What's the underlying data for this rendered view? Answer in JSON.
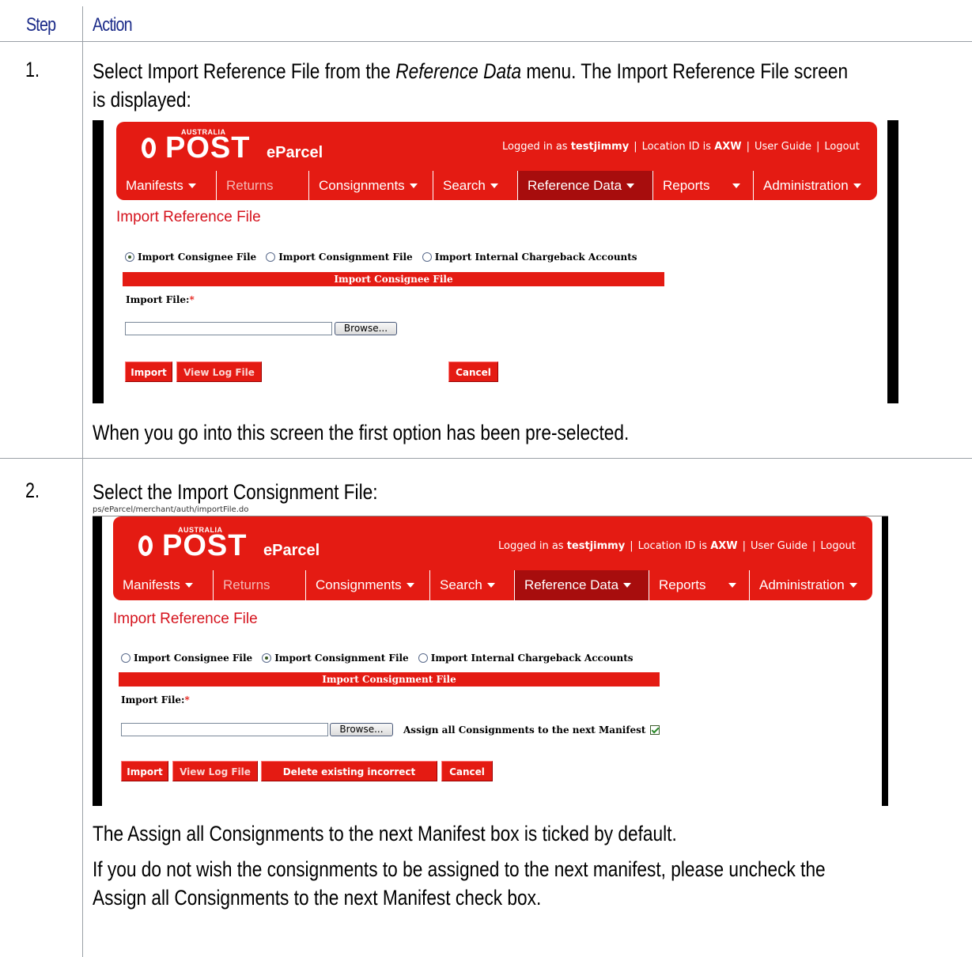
{
  "table": {
    "header": {
      "step": "Step",
      "action": "Action"
    }
  },
  "step1": {
    "number": "1.",
    "text_a": "Select ",
    "text_b": "Import Reference File",
    "text_c": " from the ",
    "text_d": "Reference Data",
    "text_e": " menu.  The ",
    "text_f": "Import Reference File",
    "text_g": " screen",
    "text_h": "is displayed:",
    "note": "When you go into this screen the first option has been pre-selected."
  },
  "step2": {
    "number": "2.",
    "text_a": "Select the ",
    "text_b": "Import Consignment File",
    "text_c": ":",
    "url": "ps/eParcel/merchant/auth/importFile.do",
    "note1_a": "The ",
    "note1_b": "Assign all Consignments to the next Manifest",
    "note1_c": " box is ticked by default.",
    "note2_line1": "If you do not wish the consignments to be assigned to the next manifest, please uncheck the",
    "note2_b": "Assign all Consignments to the next Manifest",
    "note2_c": " check box."
  },
  "app": {
    "logo_small": "AUSTRALIA",
    "logo_big": "POST",
    "logo_product": "eParcel",
    "login_prefix": "Logged in as ",
    "login_user": "testjimmy",
    "location_prefix": "Location ID is ",
    "location_id": "AXW",
    "user_guide": "User Guide",
    "logout": "Logout",
    "nav": [
      "Manifests",
      "Returns",
      "Consignments",
      "Search",
      "Reference Data",
      "Reports",
      "Administration"
    ],
    "page_title": "Import Reference File",
    "radio_options": [
      "Import Consignee File",
      "Import Consignment File",
      "Import Internal Chargeback Accounts"
    ],
    "import_file_label": "Import File:",
    "required_mark": "*",
    "browse_label": "Browse...",
    "assign_label": "Assign all Consignments to the next Manifest",
    "buttons": {
      "import": "Import",
      "view_log": "View Log File",
      "delete_incorrect": "Delete existing incorrect records",
      "cancel": "Cancel"
    }
  },
  "screen1": {
    "section_title": "Import Consignee File",
    "selected_option": 0
  },
  "screen2": {
    "section_title": "Import Consignment File",
    "selected_option": 1,
    "assign_checked": true
  },
  "colors": {
    "brand_red": "#e41b13",
    "active_nav": "#a70d0d",
    "header_blue": "#1a2a88"
  }
}
